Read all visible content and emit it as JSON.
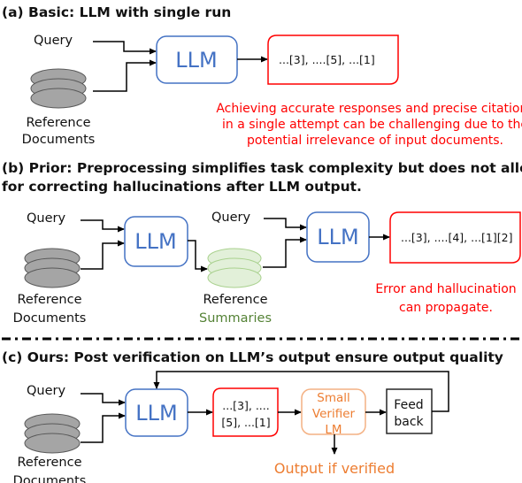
{
  "sections": {
    "a": {
      "heading": "(a) Basic: LLM with single run",
      "query": "Query",
      "docs_line1": "Reference",
      "docs_line2": "Documents",
      "llm": "LLM",
      "output": "...[3], ....[5], ...[1]",
      "note_lines": [
        "Achieving accurate responses and precise citations",
        "in a single attempt can be challenging due to the",
        "potential irrelevance of input documents."
      ]
    },
    "b": {
      "heading_lines": [
        "(b) Prior: Preprocessing simplifies task complexity but does not allow",
        "for correcting hallucinations after LLM output."
      ],
      "query1": "Query",
      "docs_line1": "Reference",
      "docs_line2": "Documents",
      "llm1": "LLM",
      "query2": "Query",
      "summaries_line1": "Reference",
      "summaries_line2": "Summaries",
      "llm2": "LLM",
      "output": "...[3], ....[4], ...[1][2]",
      "note_lines": [
        "Error and hallucination",
        "can propagate."
      ]
    },
    "c": {
      "heading": "(c) Ours: Post verification on LLM’s output ensure output quality",
      "query": "Query",
      "docs_line1": "Reference",
      "docs_line2": "Documents",
      "llm": "LLM",
      "output_lines": [
        "...[3], ....",
        "[5], ...[1]"
      ],
      "verifier_lines": [
        "Small",
        "Verifier",
        "LM"
      ],
      "feedback_lines": [
        "Feed",
        "back"
      ],
      "verified_output": "Output if verified"
    }
  },
  "colors": {
    "llm_blue": "#4472c4",
    "output_red": "#ff0000",
    "summaries_green": "#548235",
    "summaries_fill": "#e2f0d9",
    "verifier_orange": "#ed7d31",
    "docs_gray": "#a5a5a5"
  }
}
